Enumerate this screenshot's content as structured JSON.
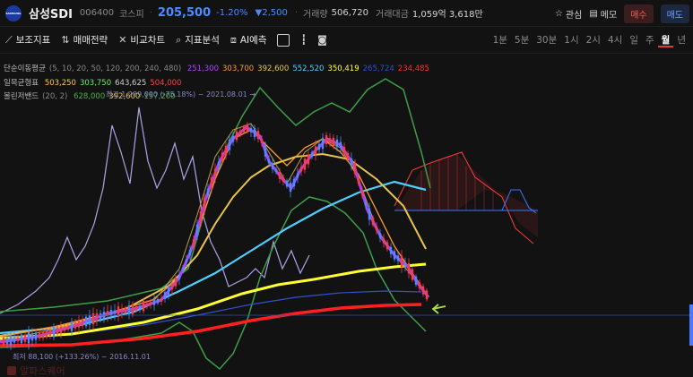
{
  "header": {
    "logo_text": "SAMSUNG",
    "stock_name": "삼성SDI",
    "code": "006400",
    "market": "코스피",
    "price": "205,500",
    "change_pct": "-1.20%",
    "change_amt": "▼2,500",
    "volume_label": "거래량",
    "volume": "506,720",
    "amount_label": "거래대금",
    "amount": "1,059억 3,618만",
    "watch_label": "관심",
    "memo_label": "메모",
    "buy_label": "매수",
    "sell_label": "매도"
  },
  "toolbar": {
    "indicator_label": "보조지표",
    "strategy_label": "매매전략",
    "compare_label": "비교차트",
    "analysis_label": "지표분석",
    "ai_label": "AI예측",
    "periods": [
      "1분",
      "5분",
      "30분",
      "1시",
      "2시",
      "4시",
      "일",
      "주",
      "월",
      "년"
    ],
    "active_period": "월"
  },
  "legend": {
    "ma": {
      "title": "단순이동평균",
      "params": "(5, 10, 20, 50, 120, 200, 240, 480)",
      "values": [
        {
          "text": "251,300",
          "color": "#b040ff"
        },
        {
          "text": "303,700",
          "color": "#ff9a2e"
        },
        {
          "text": "392,600",
          "color": "#e8c547"
        },
        {
          "text": "552,520",
          "color": "#4dd0ff"
        },
        {
          "text": "350,419",
          "color": "#ffff33"
        },
        {
          "text": "265,724",
          "color": "#3050d0"
        },
        {
          "text": "234,485",
          "color": "#ff2d2d"
        }
      ]
    },
    "ichimoku": {
      "title": "일목균형표",
      "values": [
        {
          "text": "503,250",
          "color": "#ffcc33"
        },
        {
          "text": "303,750",
          "color": "#66ee66"
        },
        {
          "text": "643,625",
          "color": "#cfcfcf"
        },
        {
          "text": "504,000",
          "color": "#ff4040"
        }
      ]
    },
    "bollinger": {
      "title": "볼린저밴드",
      "params": "(20, 2)",
      "values": [
        {
          "text": "628,000",
          "color": "#4caf50"
        },
        {
          "text": "392,600",
          "color": "#e8c547"
        },
        {
          "text": "157,200",
          "color": "#4caf50"
        }
      ]
    }
  },
  "annotations": {
    "high": "최고 1,289,000 (-75.18%) ~ 2021.08.01 →",
    "low": "최저 88,100 (+133.26%) ~ 2016.11.01"
  },
  "watermark": "알파스퀘어",
  "colors": {
    "up": "#ff3b3b",
    "down": "#4a8cff",
    "background": "#121212"
  }
}
